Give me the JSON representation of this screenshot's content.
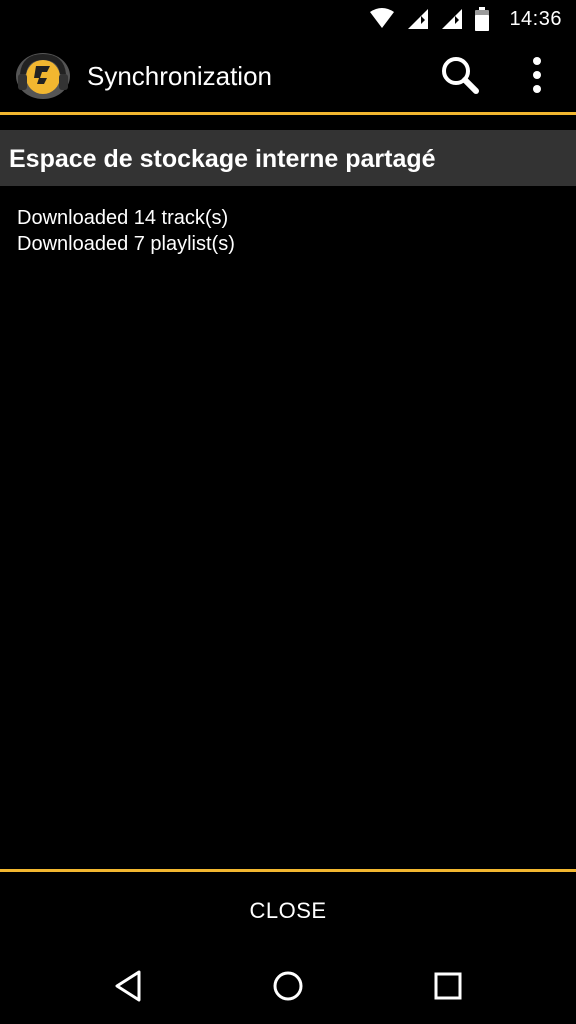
{
  "status_bar": {
    "time": "14:36",
    "icons": [
      "wifi-icon",
      "signal-icon",
      "signal-icon",
      "battery-icon"
    ]
  },
  "app_bar": {
    "title": "Synchronization",
    "logo": "app-logo-icon",
    "actions": [
      "search-icon",
      "overflow-menu-icon"
    ]
  },
  "section": {
    "title": "Espace de stockage interne partagé"
  },
  "log": {
    "lines": [
      "Downloaded 14 track(s)",
      "Downloaded 7 playlist(s)"
    ]
  },
  "footer": {
    "close_label": "CLOSE"
  },
  "nav_bar": {
    "buttons": [
      "back-icon",
      "home-icon",
      "recents-icon"
    ]
  },
  "colors": {
    "accent": "#f2b730",
    "background": "#000000",
    "section_header": "#333333",
    "text": "#ffffff"
  }
}
